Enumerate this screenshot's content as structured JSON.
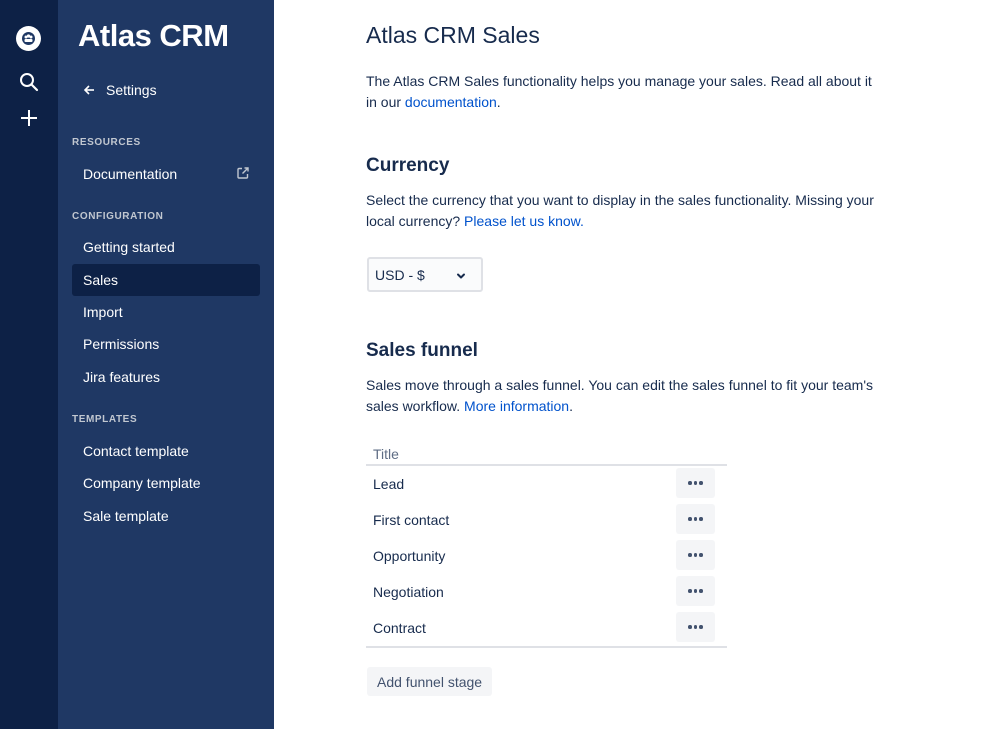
{
  "nav_rail": {
    "logo_icon": "atlas-logo-icon",
    "search_icon": "search-icon",
    "create_icon": "plus-icon"
  },
  "sidebar": {
    "brand": "Atlas CRM",
    "back_label": "Settings",
    "sections": {
      "resources": {
        "title": "RESOURCES",
        "items": [
          {
            "label": "Documentation",
            "icon": "external-link-icon"
          }
        ]
      },
      "configuration": {
        "title": "CONFIGURATION",
        "items": [
          {
            "label": "Getting started"
          },
          {
            "label": "Sales"
          },
          {
            "label": "Import"
          },
          {
            "label": "Permissions"
          },
          {
            "label": "Jira features"
          }
        ]
      },
      "templates": {
        "title": "TEMPLATES",
        "items": [
          {
            "label": "Contact template"
          },
          {
            "label": "Company template"
          },
          {
            "label": "Sale template"
          }
        ]
      }
    },
    "active_item": "Sales"
  },
  "main": {
    "title": "Atlas CRM Sales",
    "intro": {
      "text": "The Atlas CRM Sales functionality helps you manage your sales. Read all about it in our ",
      "link": "documentation",
      "suffix": "."
    },
    "currency": {
      "heading": "Currency",
      "text": "Select the currency that you want to display in the sales functionality. Missing your local currency? ",
      "link": "Please let us know.",
      "selected": "USD - $"
    },
    "funnel": {
      "heading": "Sales funnel",
      "text": "Sales move through a sales funnel. You can edit the sales funnel to fit your team's sales workflow. ",
      "link": "More information",
      "suffix": ".",
      "column_title": "Title",
      "stages": [
        {
          "title": "Lead"
        },
        {
          "title": "First contact"
        },
        {
          "title": "Opportunity"
        },
        {
          "title": "Negotiation"
        },
        {
          "title": "Contract"
        }
      ],
      "add_button": "Add funnel stage"
    }
  },
  "colors": {
    "rail": "#0D2146",
    "sidebar": "#1F3864",
    "active_item": "#0D2146",
    "link": "#0052CC",
    "text": "#172B4D"
  }
}
